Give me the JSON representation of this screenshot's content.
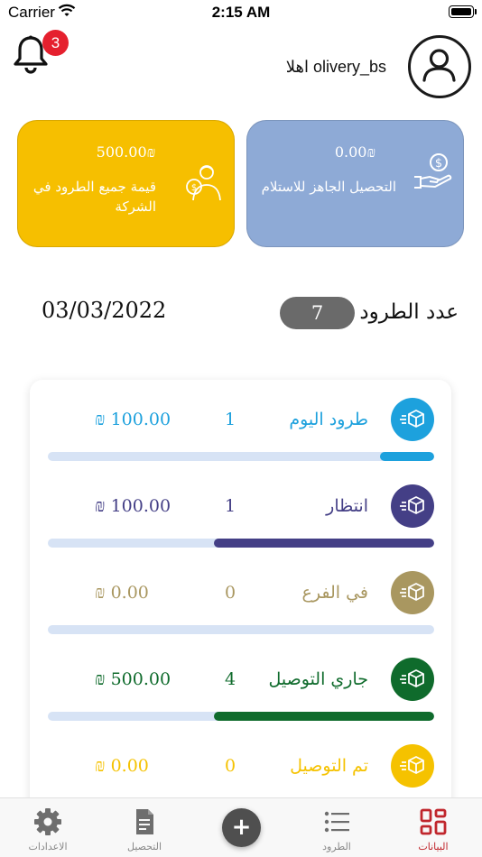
{
  "status_bar": {
    "carrier": "Carrier",
    "time": "2:15 AM"
  },
  "header": {
    "notification_count": "3",
    "greeting": "اهلا olivery_bs"
  },
  "cards": {
    "company_total": {
      "amount": "500.00₪",
      "label": "قيمة جميع الطرود في الشركة",
      "color": "#f6bf00"
    },
    "ready_collection": {
      "amount": "0.00₪",
      "label": "التحصيل الجاهز للاستلام",
      "color": "#8eaad6"
    }
  },
  "summary": {
    "count_label": "عدد الطرود",
    "count": "7",
    "date": "03/03/2022"
  },
  "rows": [
    {
      "label": "طرود اليوم",
      "count": "1",
      "amount": "₪ 100.00",
      "color": "#1da1dd",
      "progress": 0.14
    },
    {
      "label": "انتظار",
      "count": "1",
      "amount": "₪ 100.00",
      "color": "#443f86",
      "progress": 0.57
    },
    {
      "label": "في الفرع",
      "count": "0",
      "amount": "₪ 0.00",
      "color": "#a99760",
      "progress": 0
    },
    {
      "label": "جاري التوصيل",
      "count": "4",
      "amount": "₪ 500.00",
      "color": "#0f6b2c",
      "progress": 0.57
    },
    {
      "label": "تم التوصيل",
      "count": "0",
      "amount": "₪ 0.00",
      "color": "#f5c200",
      "progress": 0
    }
  ],
  "tabbar": {
    "settings": "الاعدادات",
    "collection": "التحصيل",
    "parcels": "الطرود",
    "data": "البيانات",
    "active_color": "#c0262c"
  }
}
